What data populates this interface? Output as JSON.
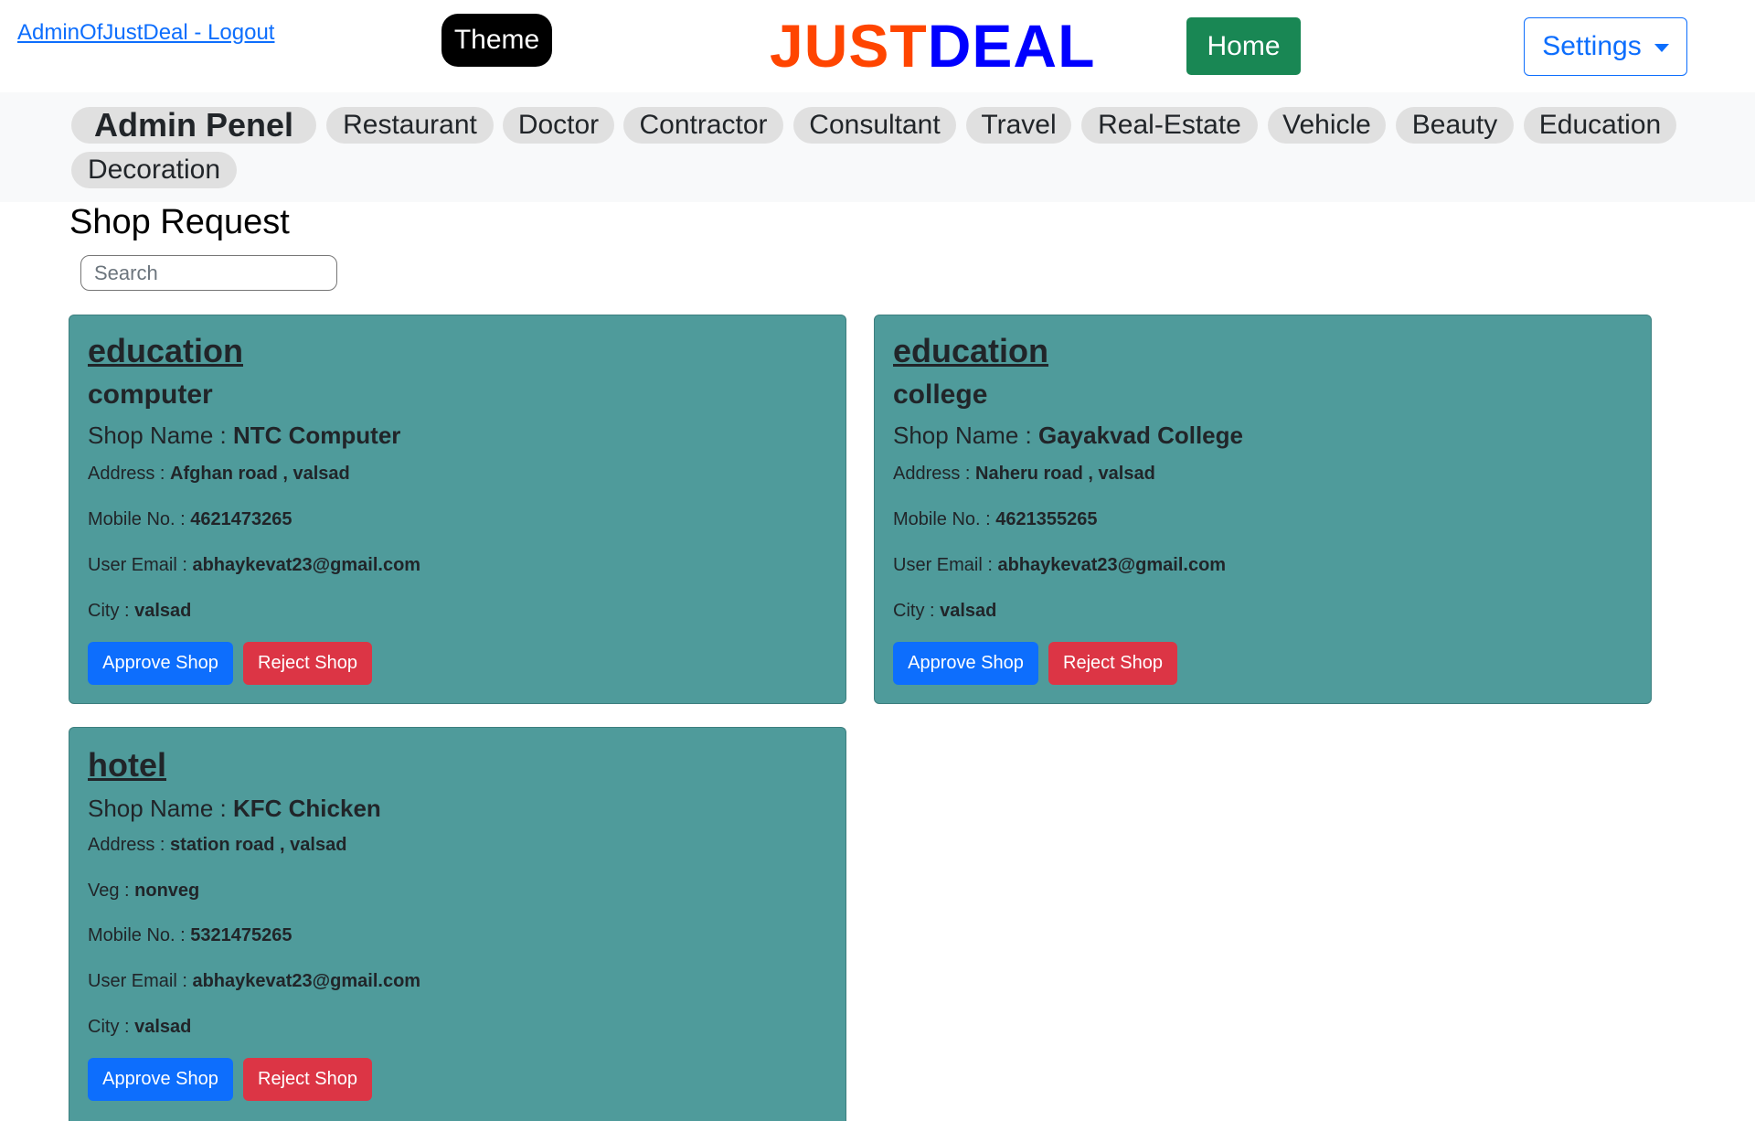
{
  "header": {
    "user_link": "AdminOfJustDeal - Logout",
    "theme_label": "Theme",
    "brand_part1": "JUST",
    "brand_part2": "DEAL",
    "home_label": "Home",
    "settings_label": "Settings"
  },
  "nav": {
    "items": [
      "Admin Penel",
      "Restaurant",
      "Doctor",
      "Contractor",
      "Consultant",
      "Travel",
      "Real-Estate",
      "Vehicle",
      "Beauty",
      "Education",
      "Decoration"
    ],
    "active": "Admin Penel"
  },
  "page": {
    "title": "Shop Request",
    "search_placeholder": "Search"
  },
  "labels": {
    "shop_name": "Shop Name : ",
    "address": "Address : ",
    "veg": "Veg : ",
    "mobile": "Mobile No. : ",
    "email": "User Email : ",
    "city": "City : ",
    "approve": "Approve Shop",
    "reject": "Reject Shop"
  },
  "cards": [
    {
      "category": "education",
      "subcategory": "computer",
      "shop_name": "NTC Computer",
      "address": "Afghan road , valsad",
      "mobile": "4621473265",
      "email": "abhaykevat23@gmail.com",
      "city": "valsad"
    },
    {
      "category": "education",
      "subcategory": "college",
      "shop_name": "Gayakvad College",
      "address": "Naheru road , valsad",
      "mobile": "4621355265",
      "email": "abhaykevat23@gmail.com",
      "city": "valsad"
    },
    {
      "category": "hotel",
      "shop_name": "KFC Chicken",
      "address": "station road , valsad",
      "veg": "nonveg",
      "mobile": "5321475265",
      "email": "abhaykevat23@gmail.com",
      "city": "valsad"
    }
  ],
  "colors": {
    "card_bg": "#4f9b9b",
    "brand_just": "#ff4500",
    "brand_deal": "#0000ff",
    "home_bg": "#198754",
    "approve_bg": "#0d6efd",
    "reject_bg": "#dc3545"
  }
}
